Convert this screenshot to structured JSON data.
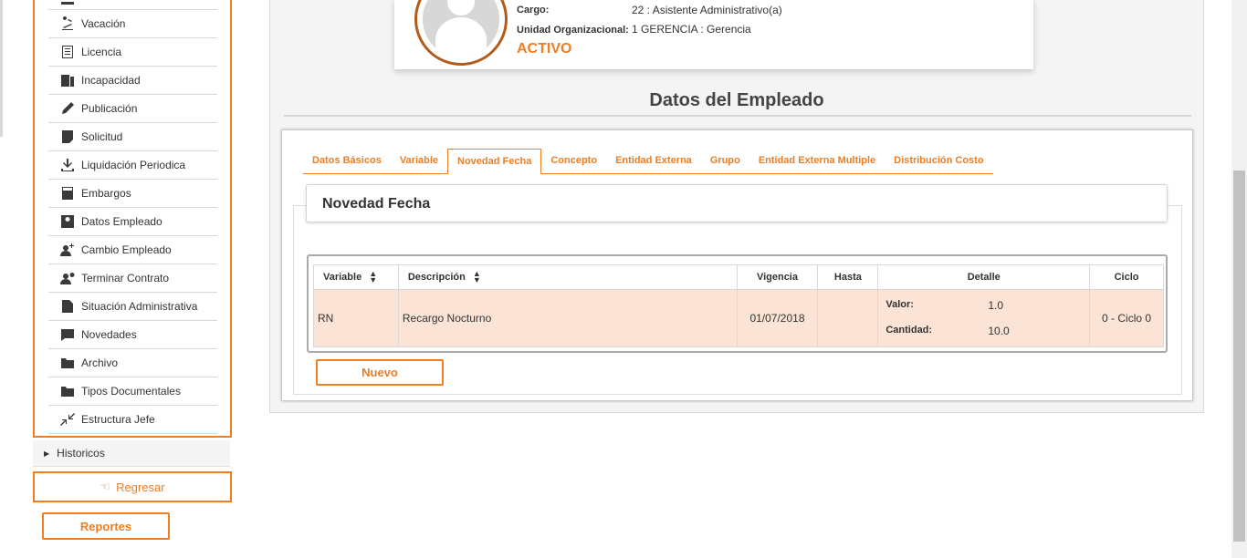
{
  "sidebar": {
    "items": [
      {
        "label": "",
        "icon": "menu-icon"
      },
      {
        "label": "Vacación",
        "icon": "vacation-icon"
      },
      {
        "label": "Licencia",
        "icon": "license-icon"
      },
      {
        "label": "Incapacidad",
        "icon": "disability-icon"
      },
      {
        "label": "Publicación",
        "icon": "publication-icon"
      },
      {
        "label": "Solicitud",
        "icon": "request-icon"
      },
      {
        "label": "Liquidación Periodica",
        "icon": "download-icon"
      },
      {
        "label": "Embargos",
        "icon": "calculator-icon"
      },
      {
        "label": "Datos Empleado",
        "icon": "employee-card-icon"
      },
      {
        "label": "Cambio Empleado",
        "icon": "user-add-icon"
      },
      {
        "label": "Terminar Contrato",
        "icon": "user-remove-icon"
      },
      {
        "label": "Situación Administrativa",
        "icon": "document-icon"
      },
      {
        "label": "Novedades",
        "icon": "chat-icon"
      },
      {
        "label": "Archivo",
        "icon": "folder-icon"
      },
      {
        "label": "Tipos Documentales",
        "icon": "folder-icon"
      },
      {
        "label": "Estructura Jefe",
        "icon": "compress-icon"
      }
    ],
    "historicos": "Historicos",
    "regresar": "Regresar",
    "reportes": "Reportes"
  },
  "profile": {
    "cargo_label": "Cargo:",
    "cargo_value": "22 : Asistente Administrativo(a)",
    "unidad_label": "Unidad Organizacional:",
    "unidad_value": "1 GERENCIA : Gerencia",
    "status": "ACTIVO"
  },
  "section_title": "Datos del Empleado",
  "tabs": [
    {
      "label": "Datos Básicos",
      "active": false
    },
    {
      "label": "Variable",
      "active": false
    },
    {
      "label": "Novedad Fecha",
      "active": true
    },
    {
      "label": "Concepto",
      "active": false
    },
    {
      "label": "Entidad Externa",
      "active": false
    },
    {
      "label": "Grupo",
      "active": false
    },
    {
      "label": "Entidad Externa Multiple",
      "active": false
    },
    {
      "label": "Distribución Costo",
      "active": false
    }
  ],
  "panel_title": "Novedad Fecha",
  "table": {
    "headers": {
      "variable": "Variable",
      "descripcion": "Descripción",
      "vigencia": "Vigencia",
      "hasta": "Hasta",
      "detalle": "Detalle",
      "ciclo": "Ciclo"
    },
    "rows": [
      {
        "variable": "RN",
        "descripcion": "Recargo Nocturno",
        "vigencia": "01/07/2018",
        "hasta": "",
        "valor_label": "Valor:",
        "valor": "1.0",
        "cantidad_label": "Cantidad:",
        "cantidad": "10.0",
        "ciclo": "0 - Ciclo 0"
      }
    ]
  },
  "nuevo_button": "Nuevo",
  "colors": {
    "accent": "#ef7d22",
    "row_highlight": "#fbe4d5"
  }
}
